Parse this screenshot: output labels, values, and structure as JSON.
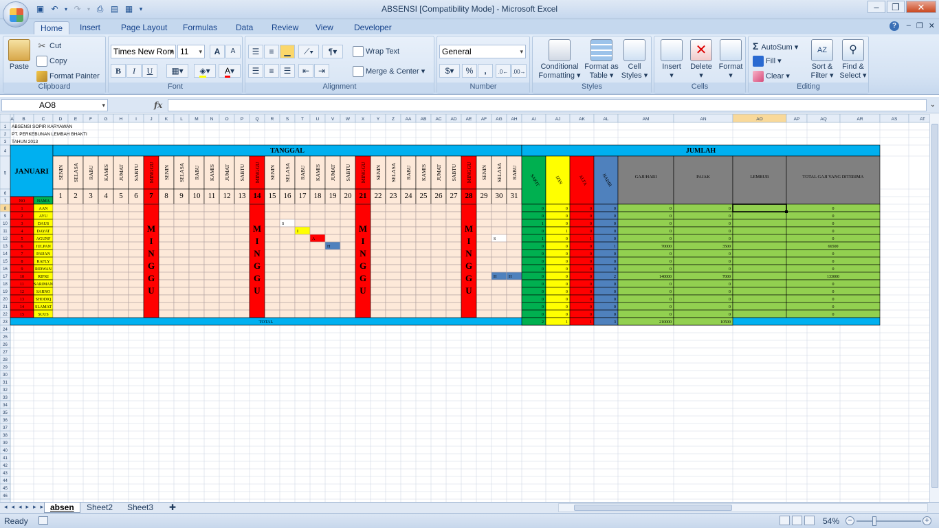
{
  "app": {
    "title": "ABSENSI  [Compatibility Mode]  -  Microsoft Excel",
    "tabs": [
      "Home",
      "Insert",
      "Page Layout",
      "Formulas",
      "Data",
      "Review",
      "View",
      "Developer"
    ],
    "help": "?"
  },
  "ribbon": {
    "clipboard": {
      "label": "Clipboard",
      "paste": "Paste",
      "cut": "Cut",
      "copy": "Copy",
      "format_painter": "Format Painter"
    },
    "font": {
      "label": "Font",
      "font_name": "Times New Rom",
      "font_size": "11",
      "bold": "B",
      "italic": "I",
      "underline": "U",
      "grow": "A",
      "shrink": "A"
    },
    "alignment": {
      "label": "Alignment",
      "wrap_text": "Wrap Text",
      "merge_center": "Merge & Center"
    },
    "number": {
      "label": "Number",
      "format": "General",
      "percent": "%",
      "comma": ","
    },
    "styles": {
      "label": "Styles",
      "conditional": "Conditional Formatting",
      "format_table": "Format as Table",
      "cell_styles": "Cell Styles"
    },
    "cells": {
      "label": "Cells",
      "insert": "Insert",
      "delete": "Delete",
      "format": "Format"
    },
    "editing": {
      "label": "Editing",
      "autosum": "AutoSum",
      "fill": "Fill",
      "clear": "Clear",
      "sort_filter": "Sort & Filter",
      "find_select": "Find & Select"
    }
  },
  "formula_bar": {
    "name_box": "AO8",
    "fx": "fx",
    "formula": ""
  },
  "sheet": {
    "column_headers": [
      "A",
      "B",
      "C",
      "D",
      "E",
      "F",
      "G",
      "H",
      "I",
      "J",
      "K",
      "L",
      "M",
      "N",
      "O",
      "P",
      "Q",
      "R",
      "S",
      "T",
      "U",
      "V",
      "W",
      "X",
      "Y",
      "Z",
      "AA",
      "AB",
      "AC",
      "AD",
      "AE",
      "AF",
      "AG",
      "AH",
      "AI",
      "AJ",
      "AK",
      "AL",
      "AM",
      "AN",
      "AO",
      "AP",
      "AQ",
      "AR",
      "AS",
      "AT"
    ],
    "title_line1": "ABSENSI SOPIR KARYAWAN",
    "title_line2": "PT. PERKEBUNAN LEMBAH BHAKTI",
    "title_line3": "TAHUN 2013",
    "month": "JANUARI",
    "tanggal_header": "TANGGAL",
    "jumlah_header": "JUMLAH",
    "col_no": "NO",
    "col_nama": "NAMA",
    "minggu_word": "MINGGU",
    "minggu_letters": [
      "M",
      "I",
      "N",
      "G",
      "G",
      "U"
    ],
    "weekday_names": [
      "SENIN",
      "SELASA",
      "RABU",
      "KAMIS",
      "JUMAT",
      "SABTU",
      "MINGGU"
    ],
    "first_day": "SENIN",
    "days": [
      1,
      2,
      3,
      4,
      5,
      6,
      7,
      8,
      9,
      10,
      11,
      12,
      13,
      14,
      15,
      16,
      17,
      18,
      19,
      20,
      21,
      22,
      23,
      24,
      25,
      26,
      27,
      28,
      29,
      30,
      31
    ],
    "sum_headers": [
      "SAKIT",
      "IZIN",
      "ALFA",
      "HADIR"
    ],
    "money_headers": [
      "GAJI/HARI",
      "PAJAK",
      "LEMBUR",
      "TOTAL GAJI YANG DITERIMA"
    ],
    "employees": [
      {
        "no": 1,
        "nama": "AAN",
        "marks": {},
        "sakit": 0,
        "izin": 0,
        "alfa": 0,
        "hadir": 0,
        "gaji": 0,
        "pajak": 0,
        "lembur": "",
        "total": 0
      },
      {
        "no": 2,
        "nama": "AYU",
        "marks": {},
        "sakit": 0,
        "izin": 0,
        "alfa": 0,
        "hadir": 0,
        "gaji": 0,
        "pajak": 0,
        "lembur": "",
        "total": 0
      },
      {
        "no": 3,
        "nama": "DAUS",
        "marks": {
          "16": "S"
        },
        "sakit": 1,
        "izin": 0,
        "alfa": 0,
        "hadir": 0,
        "gaji": 0,
        "pajak": 0,
        "lembur": "",
        "total": 0
      },
      {
        "no": 4,
        "nama": "DAYAT",
        "marks": {
          "17": "I"
        },
        "sakit": 0,
        "izin": 1,
        "alfa": 0,
        "hadir": 0,
        "gaji": 0,
        "pajak": 0,
        "lembur": "",
        "total": 0
      },
      {
        "no": 5,
        "nama": "AGUNF",
        "marks": {
          "18": "A",
          "30": "S"
        },
        "sakit": 1,
        "izin": 0,
        "alfa": 1,
        "hadir": 0,
        "gaji": 0,
        "pajak": 0,
        "lembur": "",
        "total": 0
      },
      {
        "no": 6,
        "nama": "JULPAN",
        "marks": {
          "19": "H"
        },
        "sakit": 0,
        "izin": 0,
        "alfa": 0,
        "hadir": 1,
        "gaji": 70000,
        "pajak": 3500,
        "lembur": "",
        "total": 66500
      },
      {
        "no": 7,
        "nama": "PAIJAN",
        "marks": {},
        "sakit": 0,
        "izin": 0,
        "alfa": 0,
        "hadir": 0,
        "gaji": 0,
        "pajak": 0,
        "lembur": "",
        "total": 0
      },
      {
        "no": 8,
        "nama": "RAFLY",
        "marks": {},
        "sakit": 0,
        "izin": 0,
        "alfa": 0,
        "hadir": 0,
        "gaji": 0,
        "pajak": 0,
        "lembur": "",
        "total": 0
      },
      {
        "no": 9,
        "nama": "RIDWAN",
        "marks": {},
        "sakit": 0,
        "izin": 0,
        "alfa": 0,
        "hadir": 0,
        "gaji": 0,
        "pajak": 0,
        "lembur": "",
        "total": 0
      },
      {
        "no": 10,
        "nama": "RIFKI",
        "marks": {
          "30": "H",
          "31": "H"
        },
        "sakit": 0,
        "izin": 0,
        "alfa": 0,
        "hadir": 2,
        "gaji": 140000,
        "pajak": 7000,
        "lembur": "",
        "total": 133000
      },
      {
        "no": 11,
        "nama": "SARIMAN",
        "marks": {},
        "sakit": 0,
        "izin": 0,
        "alfa": 0,
        "hadir": 0,
        "gaji": 0,
        "pajak": 0,
        "lembur": "",
        "total": 0
      },
      {
        "no": 12,
        "nama": "SARNO",
        "marks": {},
        "sakit": 0,
        "izin": 0,
        "alfa": 0,
        "hadir": 0,
        "gaji": 0,
        "pajak": 0,
        "lembur": "",
        "total": 0
      },
      {
        "no": 13,
        "nama": "SHODIQ",
        "marks": {},
        "sakit": 0,
        "izin": 0,
        "alfa": 0,
        "hadir": 0,
        "gaji": 0,
        "pajak": 0,
        "lembur": "",
        "total": 0
      },
      {
        "no": 14,
        "nama": "SLAMAT",
        "marks": {},
        "sakit": 0,
        "izin": 0,
        "alfa": 0,
        "hadir": 0,
        "gaji": 0,
        "pajak": 0,
        "lembur": "",
        "total": 0
      },
      {
        "no": 15,
        "nama": "SUUS",
        "marks": {},
        "sakit": 0,
        "izin": 0,
        "alfa": 0,
        "hadir": 0,
        "gaji": 0,
        "pajak": 0,
        "lembur": "",
        "total": 0
      }
    ],
    "total_label": "TOTAL",
    "totals": {
      "sakit": 2,
      "izin": 1,
      "alfa": 1,
      "hadir": 3,
      "gaji": 210000,
      "pajak": 10500
    },
    "row_count": 47,
    "selected_cell": "AO8"
  },
  "colors": {
    "header_blue": "#00b0f0",
    "green": "#00b050",
    "yellow": "#ffff00",
    "red": "#ff0000",
    "blue_col": "#4f81bd",
    "grey_col": "#808080",
    "light_green": "#92d050",
    "peach": "#fde9d9",
    "mark_s": "#ffffff",
    "mark_i": "#ffff00",
    "mark_a": "#ff0000",
    "mark_h": "#4f81bd"
  },
  "sheet_tabs": [
    "absen",
    "Sheet2",
    "Sheet3"
  ],
  "status": {
    "ready": "Ready",
    "zoom": "54%"
  }
}
